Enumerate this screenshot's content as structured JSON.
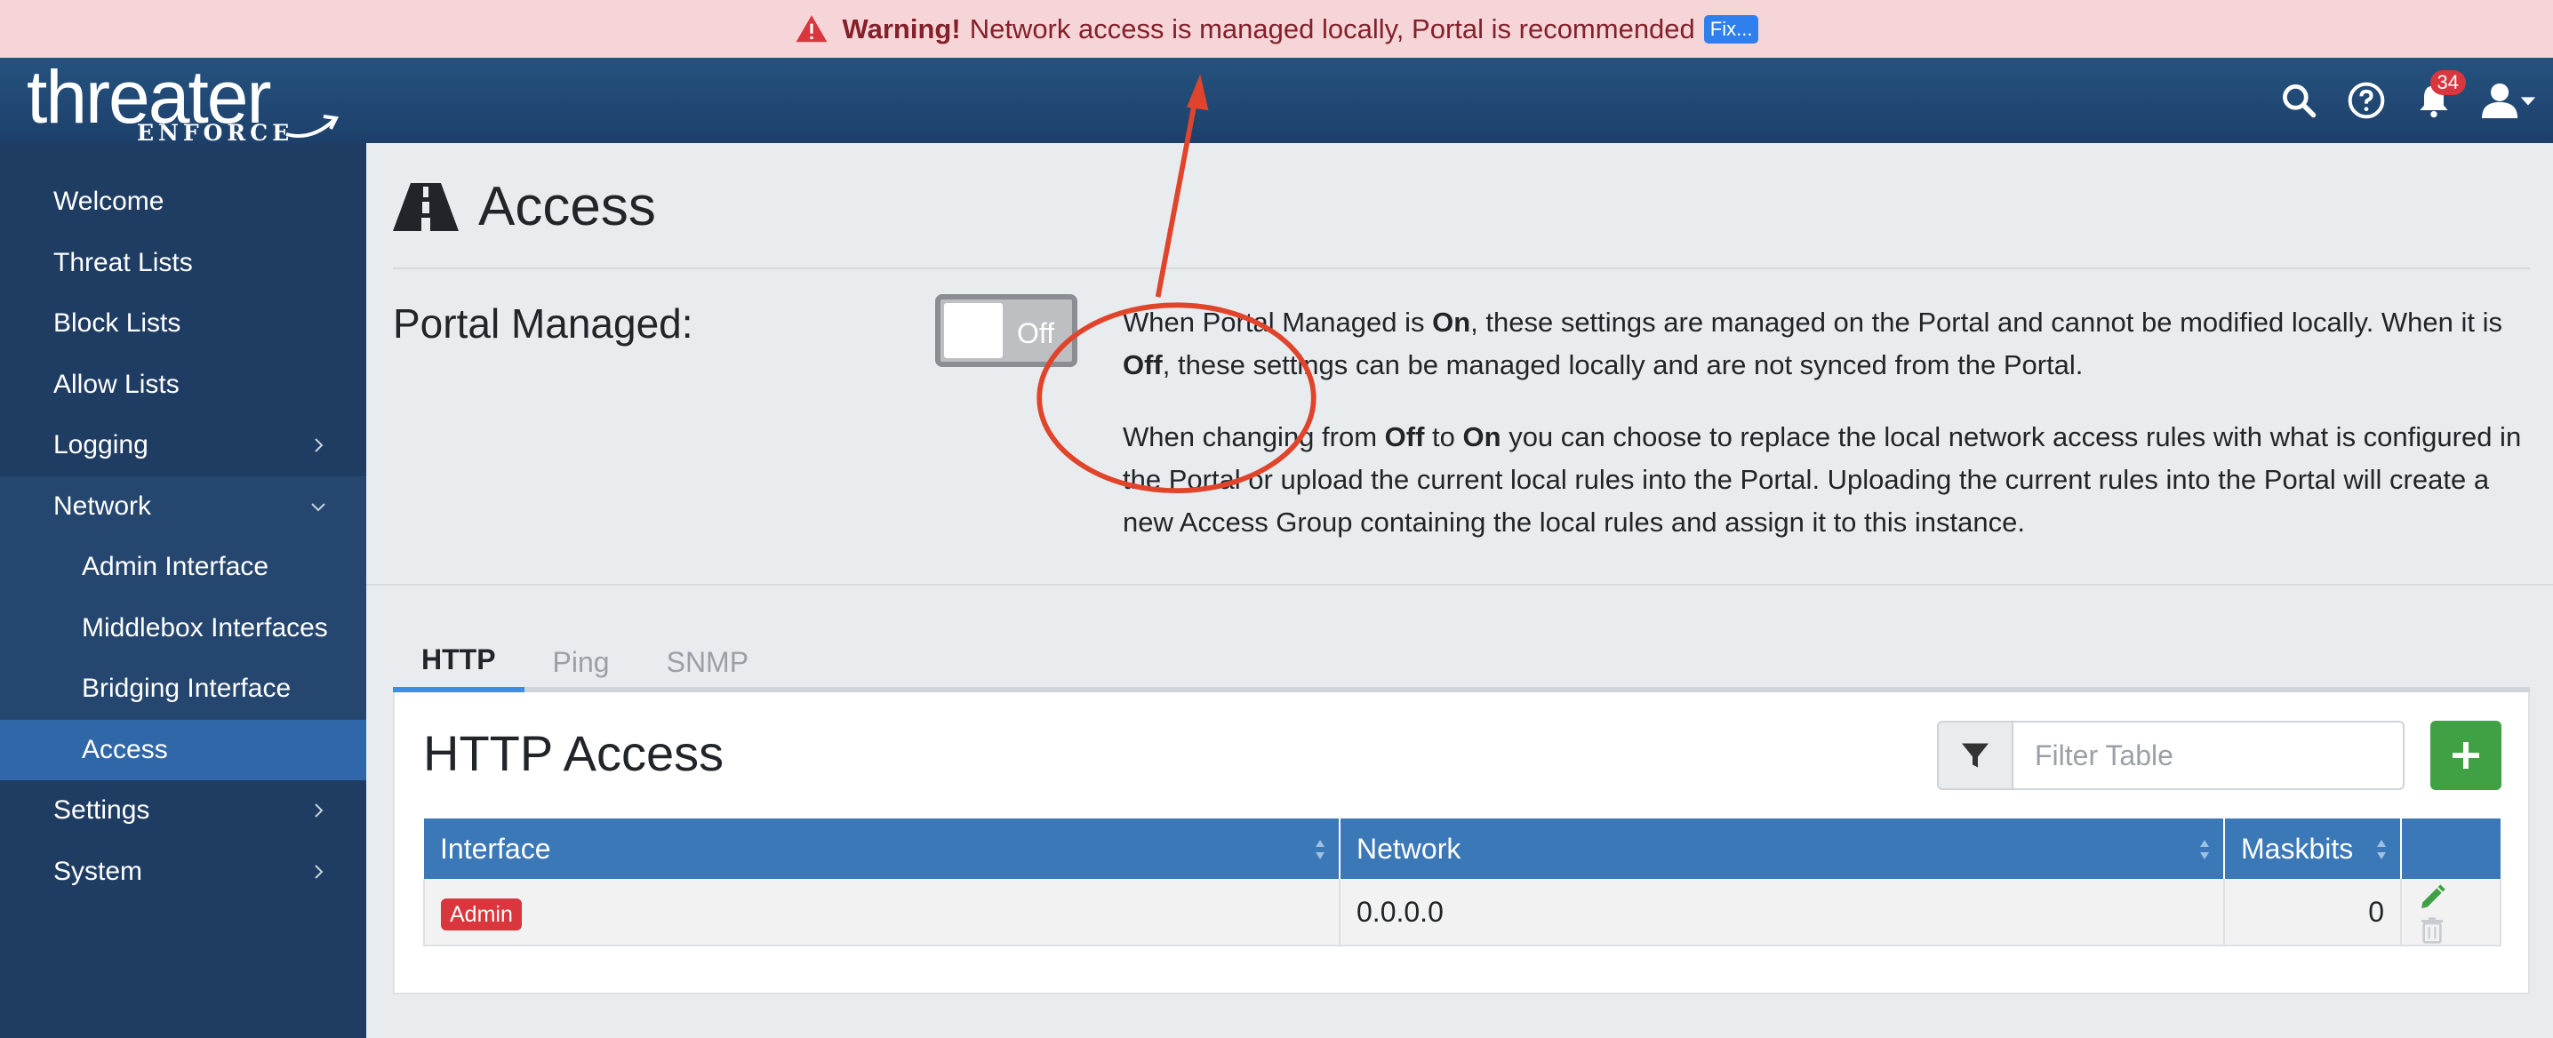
{
  "banner": {
    "strong": "Warning!",
    "message": "Network access is managed locally, Portal is recommended",
    "fix_label": "Fix..."
  },
  "brand": {
    "word": "threater",
    "sub": "ENFORCE"
  },
  "topnav": {
    "notifications_count": "34"
  },
  "sidebar": {
    "items": [
      {
        "label": "Welcome"
      },
      {
        "label": "Threat Lists"
      },
      {
        "label": "Block Lists"
      },
      {
        "label": "Allow Lists"
      },
      {
        "label": "Logging"
      },
      {
        "label": "Network"
      },
      {
        "label": "Admin Interface"
      },
      {
        "label": "Middlebox Interfaces"
      },
      {
        "label": "Bridging Interface"
      },
      {
        "label": "Access"
      },
      {
        "label": "Settings"
      },
      {
        "label": "System"
      }
    ]
  },
  "page": {
    "title": "Access",
    "portal_label": "Portal Managed:",
    "toggle_state": "Off",
    "desc1": {
      "a": "When Portal Managed is ",
      "b": "On",
      "c": ", these settings are managed on the Portal and cannot be modified locally. When it is ",
      "d": "Off",
      "e": ", these settings can be managed locally and are not synced from the Portal."
    },
    "desc2": {
      "a": "When changing from ",
      "b": "Off",
      "c": " to ",
      "d": "On",
      "e": " you can choose to replace the local network access rules with what is configured in the Portal or upload the current local rules into the Portal. Uploading the current rules into the Portal will create a new Access Group containing the local rules and assign it to this instance."
    }
  },
  "tabs": [
    {
      "label": "HTTP"
    },
    {
      "label": "Ping"
    },
    {
      "label": "SNMP"
    }
  ],
  "card": {
    "title": "HTTP Access",
    "filter_placeholder": "Filter Table",
    "columns": [
      "Interface",
      "Network",
      "Maskbits"
    ],
    "rows": [
      {
        "interface": "Admin",
        "network": "0.0.0.0",
        "maskbits": "0"
      }
    ]
  },
  "colors": {
    "accent": "#3a78b8",
    "sidebar": "#1f3d63",
    "active": "#2f67a8",
    "warning_bg": "#f6d5d8",
    "danger": "#d9363e",
    "success": "#3fa144",
    "annotation": "#e0452c"
  }
}
